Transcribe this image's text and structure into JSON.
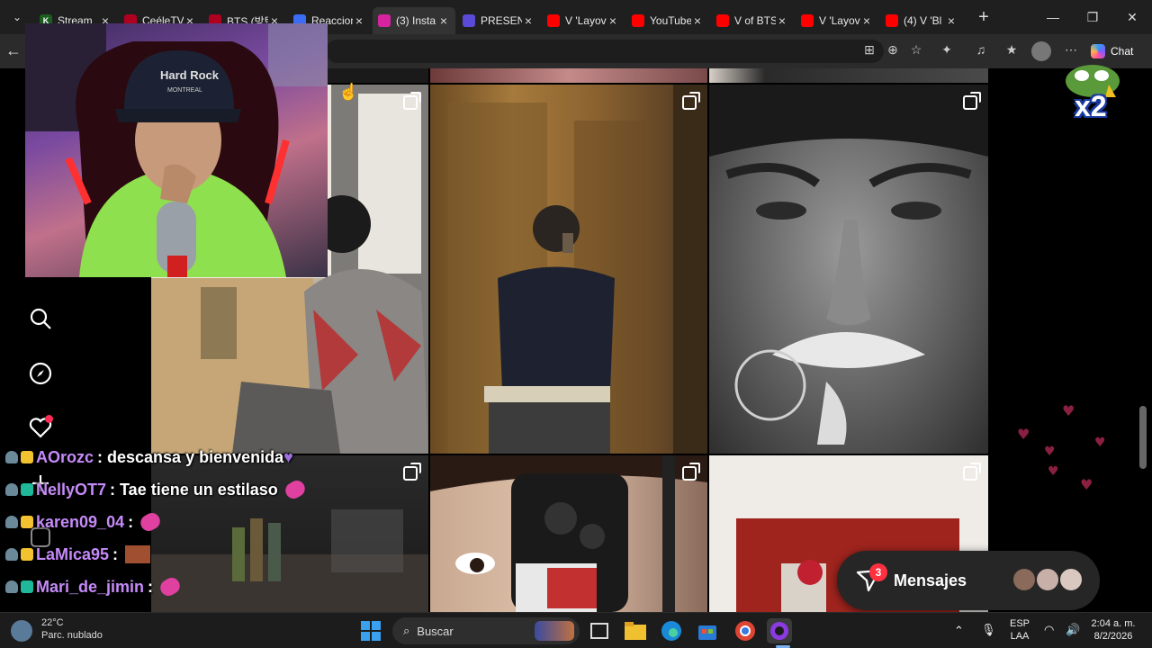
{
  "browser": {
    "tabs": [
      {
        "title": "Stream",
        "favicon_color": "#1b5e20",
        "favicon_glyph": "K"
      },
      {
        "title": "CeéleTV",
        "favicon_color": "#b00020",
        "favicon_glyph": ""
      },
      {
        "title": "BTS (방탄",
        "favicon_color": "#b00020",
        "favicon_glyph": ""
      },
      {
        "title": "Reaccion",
        "favicon_color": "#3b6cf6",
        "favicon_glyph": ""
      },
      {
        "title": "(3) Insta",
        "favicon_color": "#d6249f",
        "favicon_glyph": ""
      },
      {
        "title": "PRESEN",
        "favicon_color": "#5a4bd6",
        "favicon_glyph": ""
      },
      {
        "title": "V 'Layov",
        "favicon_color": "#ff0000",
        "favicon_glyph": ""
      },
      {
        "title": "YouTube",
        "favicon_color": "#ff0000",
        "favicon_glyph": ""
      },
      {
        "title": "V of BTS",
        "favicon_color": "#ff0000",
        "favicon_glyph": ""
      },
      {
        "title": "V 'Layov",
        "favicon_color": "#ff0000",
        "favicon_glyph": ""
      },
      {
        "title": "(4) V 'Bl",
        "favicon_color": "#ff0000",
        "favicon_glyph": ""
      }
    ],
    "active_tab_index": 4,
    "chat_label": "Chat"
  },
  "webcam": {
    "cap_text": "Hard Rock",
    "cap_subtext": "MONTREAL"
  },
  "emote_overlay": {
    "label": "x2"
  },
  "chat_messages": [
    {
      "user": "AOrozc",
      "text": ": descansa y bienvenida",
      "badges": [
        "mod",
        "crown"
      ]
    },
    {
      "user": "NellyOT7",
      "text": ": Tae tiene un estilaso",
      "badges": [
        "mod",
        "gift"
      ]
    },
    {
      "user": "karen09_04",
      "text": ":",
      "badges": [
        "mod",
        "crown"
      ]
    },
    {
      "user": "LaMica95",
      "text": ":",
      "badges": [
        "mod",
        "crown"
      ]
    },
    {
      "user": "Mari_de_jimin",
      "text": ":",
      "badges": [
        "mod",
        "gift"
      ]
    }
  ],
  "messages_button": {
    "label": "Mensajes",
    "count": "3"
  },
  "taskbar": {
    "weather_temp": "22°C",
    "weather_desc": "Parc. nublado",
    "search_placeholder": "Buscar",
    "lang_top": "ESP",
    "lang_bottom": "LAA",
    "time": "2:04 a. m.",
    "date": "8/2/2026"
  }
}
